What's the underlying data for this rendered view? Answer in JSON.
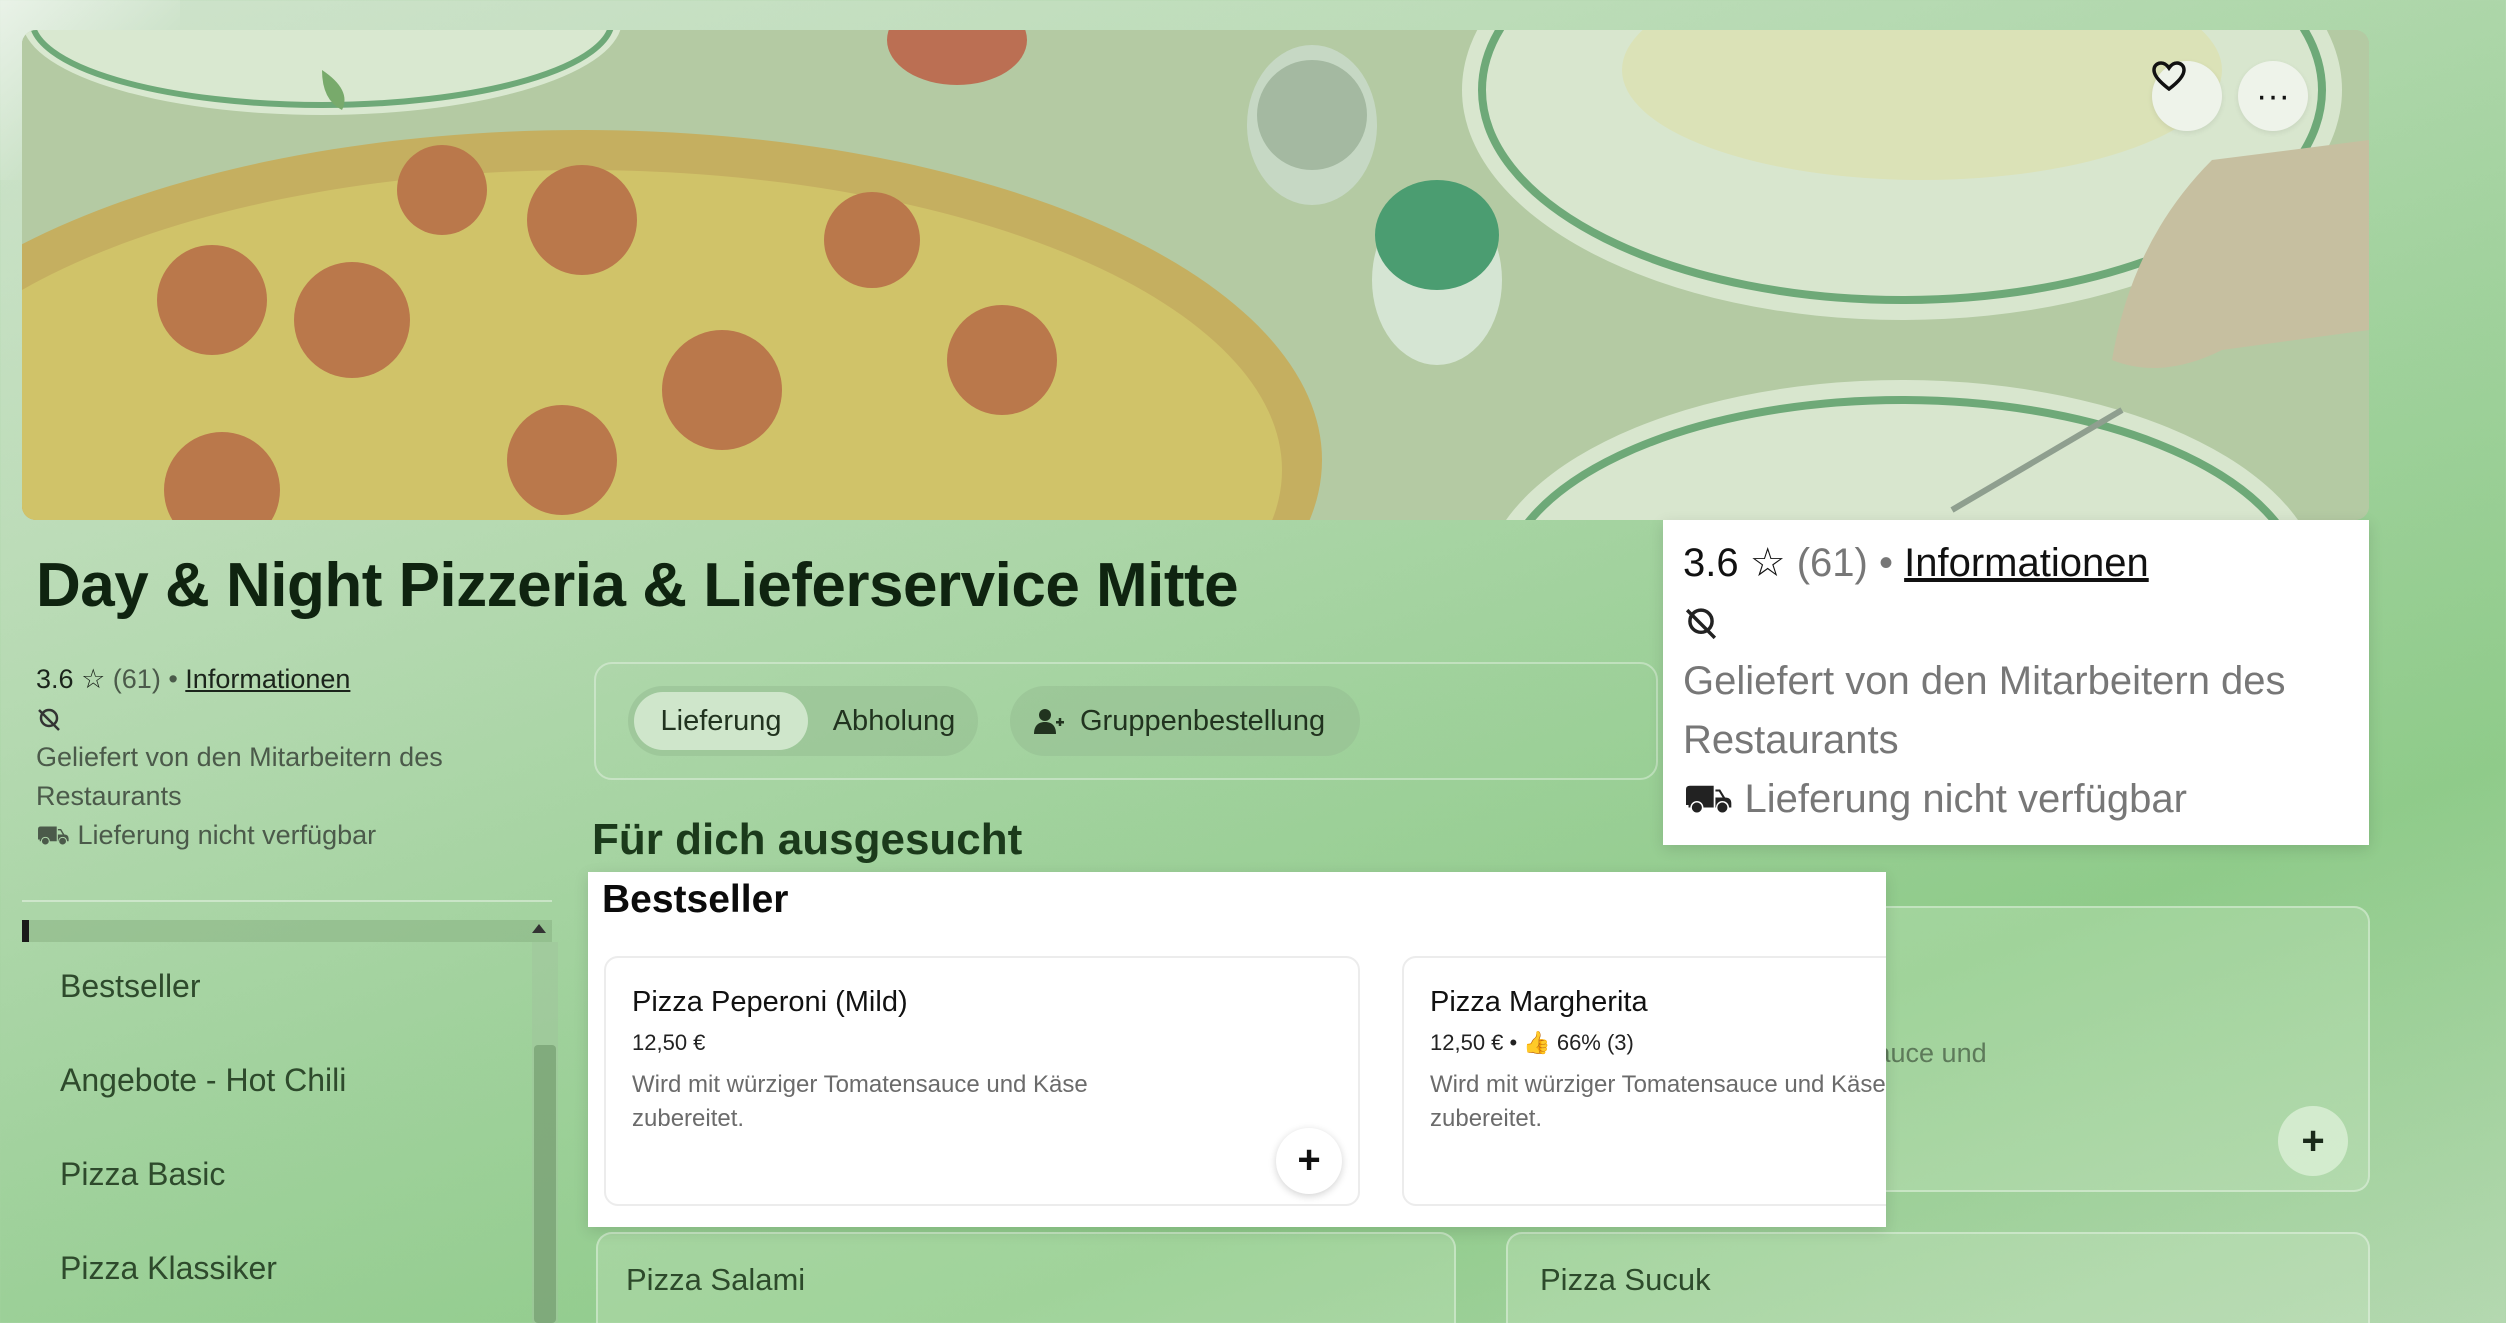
{
  "store": {
    "name": "Day & Night Pizzeria & Lieferservice Mitte",
    "rating": "3.6",
    "review_count": "(61)",
    "info_link": "Informationen",
    "delivered_by": " Geliefert von den Mitarbeitern des Restaurants",
    "delivery_status": "Lieferung nicht verfügbar"
  },
  "hero": {
    "favorite_icon": "heart-icon",
    "more_icon": "ellipsis-icon",
    "more_label": "···"
  },
  "toolbar": {
    "delivery_label": "Lieferung",
    "pickup_label": "Abholung",
    "group_order_label": "Gruppenbestellung",
    "selected_mode": "Lieferung"
  },
  "section_heading": "Für dich ausgesucht",
  "sidebar": {
    "items": [
      {
        "label": "Bestseller"
      },
      {
        "label": "Angebote - Hot Chili"
      },
      {
        "label": "Pizza Basic"
      },
      {
        "label": "Pizza Klassiker"
      }
    ]
  },
  "bestseller": {
    "title": "Bestseller",
    "products": [
      {
        "name": "Pizza Peperoni (Mild)",
        "price": "12,50 €",
        "rating_text": "",
        "description": "Wird mit würziger Tomatensauce und Käse zubereitet."
      },
      {
        "name": "Pizza Margherita",
        "price": "12,50 €",
        "rating_text": " • 👍 66% (3)",
        "description": "Wird mit würziger Tomatensauce und Käse zubereitet."
      }
    ],
    "add_label": "+"
  },
  "background_cards": {
    "partial_text": "sauce und",
    "row2": [
      {
        "name": "Pizza Salami"
      },
      {
        "name": "Pizza Sucuk"
      }
    ],
    "add_label": "+"
  },
  "colors": {
    "page_tint": "#9fd19b",
    "title_green": "#0f2410",
    "popup_bg": "#ffffff"
  }
}
